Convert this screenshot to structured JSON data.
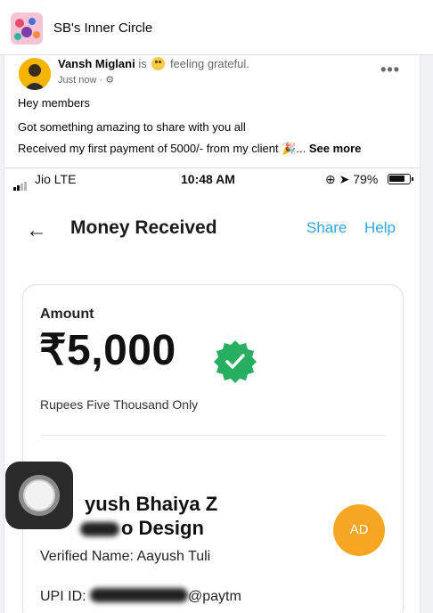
{
  "group": {
    "name": "SB's Inner Circle"
  },
  "post": {
    "author": "Vansh Miglani",
    "feeling_prefix": "is",
    "feeling": "feeling grateful.",
    "time": "Just now ·",
    "more_options_icon": "more-horizontal-icon",
    "lines": [
      "Hey members",
      "Got something amazing to share with you all",
      "Received my first payment of 5000/- from my client 🎉..."
    ],
    "see_more": "See more"
  },
  "screenshot": {
    "status": {
      "carrier": "Jio  LTE",
      "time": "10:48 AM",
      "battery": "79%"
    },
    "title": "Money Received",
    "share": "Share",
    "help": "Help",
    "amount_label": "Amount",
    "amount": "₹5,000",
    "amount_words": "Rupees Five Thousand Only",
    "payee_line1": "yush Bhaiya Z",
    "payee_line2": "o Design",
    "verified_name": "Verified Name: Aayush Tuli",
    "upi_prefix": "UPI ID:",
    "upi_suffix": "@paytm",
    "avatar_initials": "AD"
  },
  "colors": {
    "link": "#2fa6e8",
    "badge": "#27ae60",
    "avatar_ad": "#f6a623"
  }
}
